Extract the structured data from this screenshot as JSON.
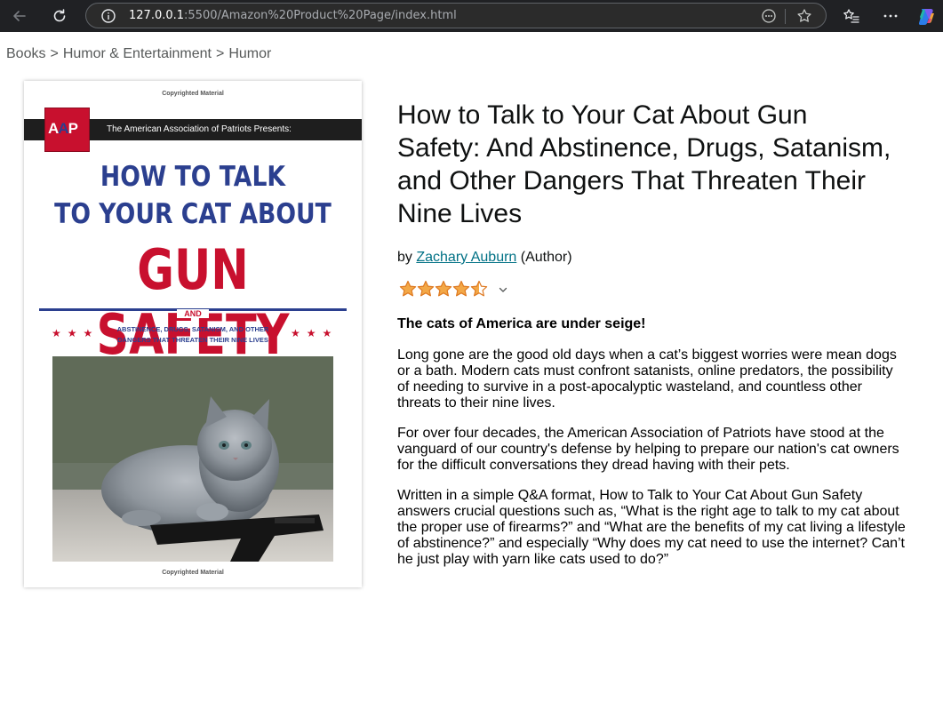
{
  "browser": {
    "url_host": "127.0.0.1",
    "url_path": ":5500/Amazon%20Product%20Page/index.html"
  },
  "breadcrumb": [
    "Books",
    "Humor & Entertainment",
    "Humor"
  ],
  "breadcrumb_separator": ">",
  "cover": {
    "copyright_top": "Copyrighted Material",
    "copyright_bottom": "Copyrighted Material",
    "logo_letters": [
      "A",
      "A",
      "P"
    ],
    "publisher": "The American Association of Patriots Presents:",
    "title_line_1": "HOW TO TALK",
    "title_line_2": "TO YOUR CAT ABOUT",
    "title_line_3": "GUN SAFETY",
    "and": "AND",
    "subtitle_line_1": "ABSTINENCE, DRUGS, SATANISM, AND OTHER",
    "subtitle_line_2": "DANGERS THAT THREATEN THEIR NINE LIVES",
    "stars_left": "★★★",
    "stars_right": "★★★"
  },
  "product": {
    "title": "How to Talk to Your Cat About Gun Safety: And Abstinence, Drugs, Satanism, and Other Dangers That Threaten Their Nine Lives",
    "by_prefix": "by",
    "author": "Zachary Auburn",
    "author_role": "(Author)",
    "rating": 4.5,
    "rating_max": 5,
    "tagline": "The cats of America are under seige!",
    "description": [
      "Long gone are the good old days when a cat’s biggest worries were mean dogs or a bath. Modern cats must confront satanists, online predators, the possibility of needing to survive in a post-apocalyptic wasteland, and countless other threats to their nine lives.",
      "For over four decades, the American Association of Patriots have stood at the vanguard of our country's defense by helping to prepare our nation's cat owners for the difficult conversations they dread having with their pets.",
      "Written in a simple Q&A format, How to Talk to Your Cat About Gun Safety answers crucial questions such as, “What is the right age to talk to my cat about the proper use of firearms?” and “What are the benefits of my cat living a lifestyle of abstinence?” and especially “Why does my cat need to use the internet? Can’t he just play with yarn like cats used to do?”"
    ]
  },
  "colors": {
    "link": "#007185",
    "star": "#f3a847",
    "cover_blue": "#2b3f8f",
    "cover_red": "#c8102e"
  }
}
